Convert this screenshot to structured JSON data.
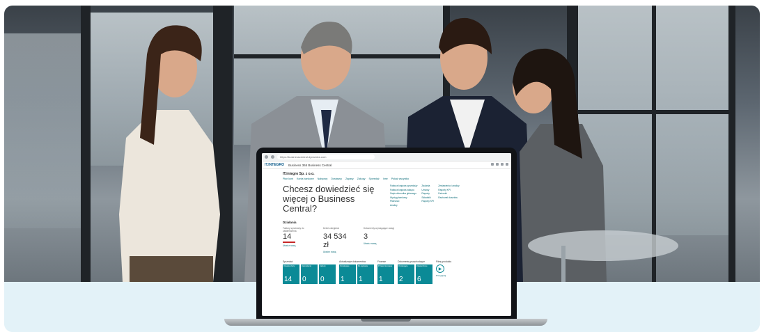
{
  "browser": {
    "url": "https://businesscentral.dynamics.com",
    "logo_text": "IT.INTEGRO",
    "app_title": "Business 365 Business Central"
  },
  "bc": {
    "company": "IT.integro Sp. z o.o.",
    "nav_items": [
      "Plan kont",
      "Konta bankowe",
      "Nabywcy",
      "Dostawcy",
      "Zapasy",
      "Zakupy",
      "Sprzedaż",
      "Inne",
      "Pokaż wszystko"
    ],
    "headline": "Chcesz dowiedzieć się więcej o Business Central?",
    "link_cols": [
      [
        "Faktura krajowa sprzedaży",
        "Faktura krajowa zakupu",
        "Zapis dziennika głównego",
        "Wyciąg bankowy",
        "Płatności",
        "Analizy"
      ],
      [
        "Zadania",
        "Umowy",
        "Raporty",
        "Składniki",
        "Raporty KPI"
      ],
      [
        "Zestawienia i analizy",
        "Raporty KPI",
        "Dziennik",
        "Rachunek kosztów"
      ]
    ],
    "section_title": "Działania",
    "kpis": [
      {
        "label": "Faktury sprzedaży do zatwierdzenia",
        "value": "14",
        "link": "Utwórz nową"
      },
      {
        "label": "Dzień zaległości",
        "value": "34 534 zł",
        "link": "Utwórz nową"
      },
      {
        "label": "Dokumenty wymagające uwagi",
        "value": "3",
        "link": "Utwórz nową"
      }
    ],
    "tile_groups": [
      {
        "title": "Sprzedaż",
        "tiles": [
          {
            "label": "Otwarte oferty",
            "value": "14"
          },
          {
            "label": "Zamówienia",
            "value": "0"
          },
          {
            "label": "Faktury",
            "value": "0"
          }
        ]
      },
      {
        "title": "Aktualizacje dokumentów",
        "tiles": [
          {
            "label": "Oczekujące",
            "value": "1"
          },
          {
            "label": "Do wysłania",
            "value": "1"
          }
        ]
      },
      {
        "title": "Finanse",
        "tiles": [
          {
            "label": "Przeterminowane",
            "value": "1"
          }
        ]
      },
      {
        "title": "Dokumenty przychodzące",
        "tiles": [
          {
            "label": "Oczekujące",
            "value": "2"
          },
          {
            "label": "Zatwierdzone",
            "value": "6"
          }
        ]
      }
    ],
    "product_videos": {
      "title": "Filmy produktu",
      "link": "Przeglądaj"
    }
  },
  "colors": {
    "band": "#e3f2f8",
    "teal_tile": "#0b8a96",
    "link": "#0a6b78"
  }
}
